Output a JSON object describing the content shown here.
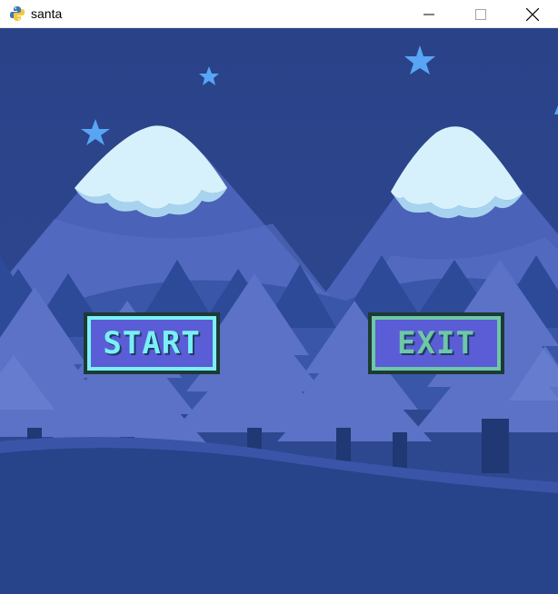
{
  "window": {
    "title": "santa",
    "app_icon": "python-icon",
    "controls": [
      "minimize-icon",
      "maximize-icon",
      "close-icon"
    ]
  },
  "scene": {
    "background": "night-snowy-mountains-forest",
    "colors": {
      "sky": "#2b4389",
      "mountain": "#4b63b8",
      "snow": "#d6f1fb",
      "trees_dark": "#2e4d9a",
      "trees_light": "#6076c9",
      "ground": "#27438a",
      "star": "#58a5f5"
    }
  },
  "menu": {
    "start_label": "START",
    "exit_label": "EXIT"
  }
}
